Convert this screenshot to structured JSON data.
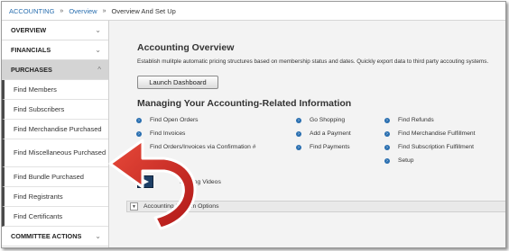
{
  "breadcrumb": {
    "root": "ACCOUNTING",
    "sep1": "»",
    "level2": "Overview",
    "sep2": "»",
    "current": "Overview And Set Up"
  },
  "sidebar": {
    "overview": "OVERVIEW",
    "financials": "FINANCIALS",
    "purchases": "PURCHASES",
    "items": [
      "Find Members",
      "Find Subscribers",
      "Find Merchandise Purchased",
      "Find Miscellaneous Purchased",
      "Find Bundle Purchased",
      "Find Registrants",
      "Find Certificants"
    ],
    "committee_actions": "COMMITTEE ACTIONS",
    "chevron_down": "⌄",
    "chevron_up": "^"
  },
  "main": {
    "overview_title": "Accounting Overview",
    "overview_desc": "Establish mulitple automatic pricing structures based on membership status and dates. Quickly export data to third party accouting systems.",
    "launch_label": "Launch Dashboard",
    "manage_title": "Managing Your Accounting-Related Information",
    "col1": [
      "Find Open Orders",
      "Find Invoices",
      "Find Orders/Invoices via Confirmation #"
    ],
    "col2": [
      "Go Shopping",
      "Add a Payment",
      "Find Payments"
    ],
    "col3": [
      "Find Refunds",
      "Find Merchandise Fulfillment",
      "Find Subscription Fulfillment",
      "Setup"
    ],
    "link_arrow": "›",
    "training_label": "Training Videos",
    "options_label": "Accounting System Options",
    "options_caret": "▼"
  },
  "colors": {
    "link_blue": "#2a6fb0",
    "active_section": "#d4d4d4",
    "arrow_red": "#cc2020"
  },
  "icons": {
    "film": "video-icon",
    "curved_arrow": "curved-arrow-icon"
  }
}
